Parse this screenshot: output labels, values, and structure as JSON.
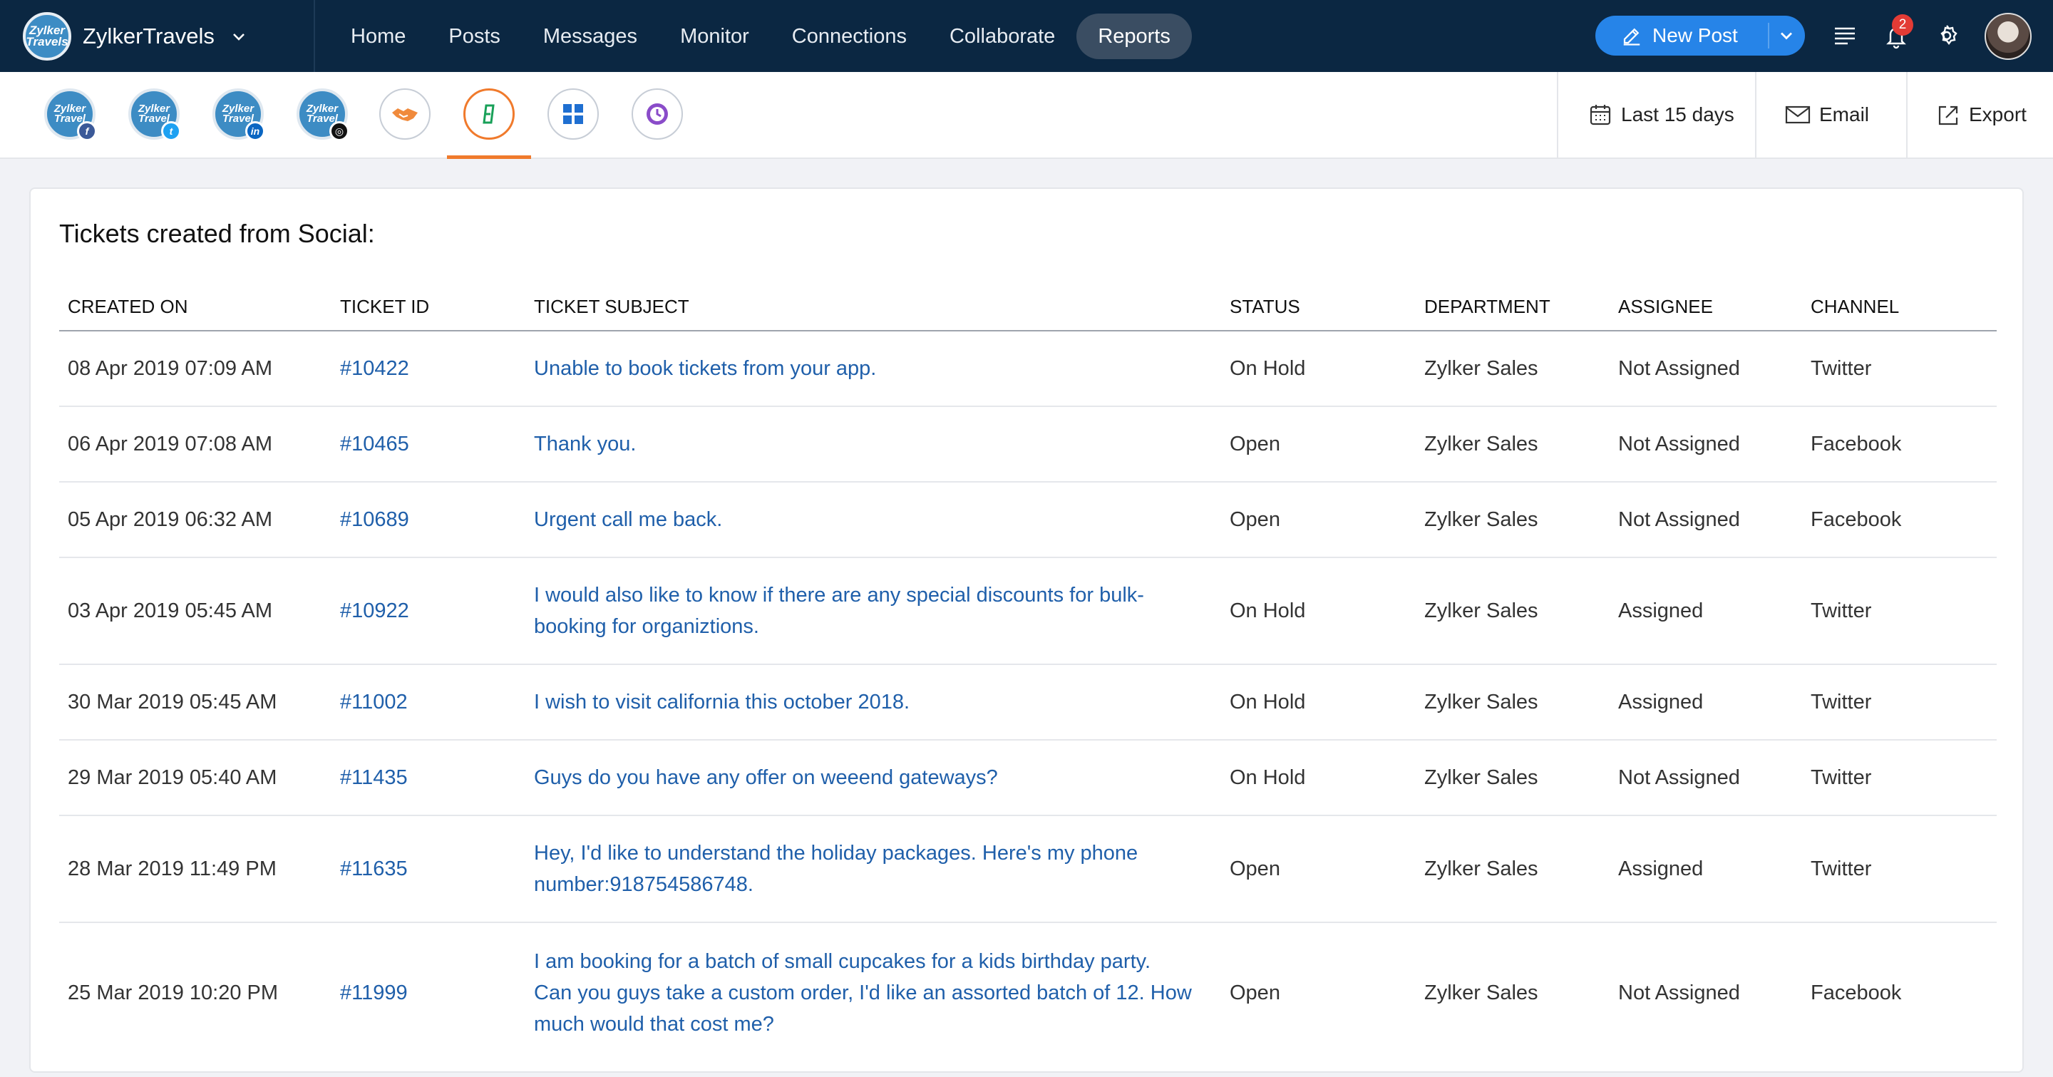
{
  "brand": {
    "name": "ZylkerTravels",
    "logo_text": "Zylker Travels"
  },
  "nav": {
    "items": [
      {
        "label": "Home",
        "active": false
      },
      {
        "label": "Posts",
        "active": false
      },
      {
        "label": "Messages",
        "active": false
      },
      {
        "label": "Monitor",
        "active": false
      },
      {
        "label": "Connections",
        "active": false
      },
      {
        "label": "Collaborate",
        "active": false
      },
      {
        "label": "Reports",
        "active": true
      }
    ],
    "new_post_label": "New Post",
    "notification_count": "2"
  },
  "channels": [
    {
      "name": "facebook-channel",
      "logo_text": "Zylker Travel",
      "network": "facebook",
      "badge_color": "#3b5998"
    },
    {
      "name": "twitter-channel",
      "logo_text": "Zylker Travel",
      "network": "twitter",
      "badge_color": "#1da1f2"
    },
    {
      "name": "linkedin-channel",
      "logo_text": "Zylker Travel",
      "network": "linkedin",
      "badge_color": "#0a66c2"
    },
    {
      "name": "instagram-channel",
      "logo_text": "Zylker Travel",
      "network": "instagram",
      "badge_color": "#111111"
    }
  ],
  "toolbar": {
    "date_range": "Last 15 days",
    "email_label": "Email",
    "export_label": "Export"
  },
  "report": {
    "title": "Tickets created from Social:",
    "columns": [
      "CREATED ON",
      "TICKET ID",
      "TICKET SUBJECT",
      "STATUS",
      "DEPARTMENT",
      "ASSIGNEE",
      "CHANNEL"
    ],
    "rows": [
      {
        "created": "08 Apr 2019 07:09 AM",
        "id": "#10422",
        "subject": "Unable to book tickets from your app.",
        "status": "On Hold",
        "dept": "Zylker Sales",
        "assignee": "Not Assigned",
        "channel": "Twitter"
      },
      {
        "created": "06 Apr 2019 07:08 AM",
        "id": "#10465",
        "subject": "Thank you.",
        "status": "Open",
        "dept": "Zylker Sales",
        "assignee": "Not Assigned",
        "channel": "Facebook"
      },
      {
        "created": "05 Apr 2019 06:32 AM",
        "id": "#10689",
        "subject": "Urgent call me back.",
        "status": "Open",
        "dept": "Zylker Sales",
        "assignee": "Not Assigned",
        "channel": "Facebook"
      },
      {
        "created": "03 Apr 2019 05:45 AM",
        "id": "#10922",
        "subject": "I would also like to know if there are any special discounts for bulk-booking for organiztions.",
        "status": "On Hold",
        "dept": "Zylker Sales",
        "assignee": "Assigned",
        "channel": "Twitter"
      },
      {
        "created": "30 Mar 2019 05:45 AM",
        "id": "#11002",
        "subject": "I wish to visit california this october 2018.",
        "status": "On Hold",
        "dept": "Zylker Sales",
        "assignee": "Assigned",
        "channel": "Twitter"
      },
      {
        "created": "29 Mar 2019 05:40 AM",
        "id": "#11435",
        "subject": "Guys do you have any offer on weeend gateways?",
        "status": "On Hold",
        "dept": "Zylker Sales",
        "assignee": "Not Assigned",
        "channel": "Twitter"
      },
      {
        "created": "28 Mar 2019 11:49 PM",
        "id": "#11635",
        "subject": "Hey, I'd like to understand the holiday packages. Here's my phone number:918754586748.",
        "status": "Open",
        "dept": "Zylker Sales",
        "assignee": "Assigned",
        "channel": "Twitter"
      },
      {
        "created": "25 Mar 2019 10:20 PM",
        "id": "#11999",
        "subject": "I am booking for a batch of small cupcakes for a kids birthday party. Can you guys take a custom order, I'd like an assorted batch of 12. How much would that cost me?",
        "status": "Open",
        "dept": "Zylker Sales",
        "assignee": "Not Assigned",
        "channel": "Facebook"
      }
    ]
  }
}
